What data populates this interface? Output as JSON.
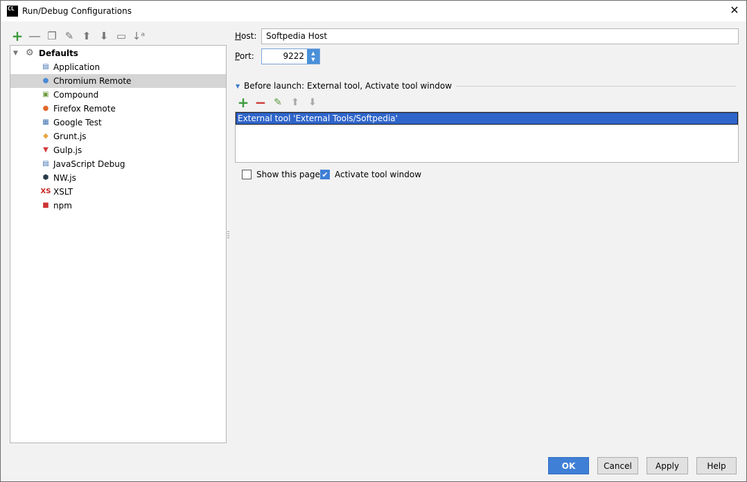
{
  "window": {
    "app_icon": "CL",
    "title": "Run/Debug Configurations",
    "close_glyph": "✕"
  },
  "left_toolbar": [
    {
      "name": "add-config-button",
      "icon": "plus-icon",
      "glyph": "+"
    },
    {
      "name": "remove-config-button",
      "icon": "minus-icon",
      "glyph": "—"
    },
    {
      "name": "copy-config-button",
      "icon": "copy-icon",
      "glyph": "❐"
    },
    {
      "name": "edit-defaults-button",
      "icon": "wrench-icon",
      "glyph": "✎"
    },
    {
      "name": "move-up-button",
      "icon": "arrow-up-icon",
      "glyph": "⬆"
    },
    {
      "name": "move-down-button",
      "icon": "arrow-down-icon",
      "glyph": "⬇"
    },
    {
      "name": "folder-button",
      "icon": "folder-icon",
      "glyph": "▭"
    },
    {
      "name": "sort-button",
      "icon": "sort-az-icon",
      "glyph": "↓ᵃ"
    }
  ],
  "tree": {
    "root_label": "Defaults",
    "items": [
      {
        "label": "Application",
        "icon": "application-icon",
        "glyph": "▤",
        "color": "#3c6fb0"
      },
      {
        "label": "Chromium Remote",
        "icon": "chromium-icon",
        "glyph": "●",
        "color": "#4a8ad4"
      },
      {
        "label": "Compound",
        "icon": "compound-icon",
        "glyph": "▣",
        "color": "#6a9a3a"
      },
      {
        "label": "Firefox Remote",
        "icon": "firefox-icon",
        "glyph": "●",
        "color": "#e0682a"
      },
      {
        "label": "Google Test",
        "icon": "google-test-icon",
        "glyph": "▦",
        "color": "#3c6fb0"
      },
      {
        "label": "Grunt.js",
        "icon": "grunt-icon",
        "glyph": "◆",
        "color": "#e8a33a"
      },
      {
        "label": "Gulp.js",
        "icon": "gulp-icon",
        "glyph": "▼",
        "color": "#d33a3a"
      },
      {
        "label": "JavaScript Debug",
        "icon": "javascript-debug-icon",
        "glyph": "▤",
        "color": "#3c6fb0"
      },
      {
        "label": "NW.js",
        "icon": "nwjs-icon",
        "glyph": "⬢",
        "color": "#2b3a4a"
      },
      {
        "label": "XSLT",
        "icon": "xslt-icon",
        "glyph": "XS",
        "color": "#cc2222"
      },
      {
        "label": "npm",
        "icon": "npm-icon",
        "glyph": "■",
        "color": "#cc3333"
      }
    ],
    "selected_index": 1
  },
  "form": {
    "host_label": "Host:",
    "host_mnemonic": "H",
    "host_rest": "ost:",
    "host_value": "Softpedia Host",
    "port_label": "Port:",
    "port_mnemonic": "P",
    "port_rest": "ort:",
    "port_value": "9222"
  },
  "before_launch": {
    "title": "Before launch: External tool, Activate tool window",
    "tasks": [
      "External tool 'External Tools/Softpedia'"
    ]
  },
  "checkboxes": {
    "show_page_label": "Show this page",
    "show_page_checked": false,
    "activate_tool_label": "Activate tool window",
    "activate_tool_checked": true
  },
  "buttons": {
    "ok": "OK",
    "cancel": "Cancel",
    "apply": "Apply",
    "help": "Help"
  },
  "colors": {
    "selection": "#2f65ca",
    "primary_button": "#3f7fd6",
    "add_green": "#3a9a3a",
    "remove_red": "#cc3333"
  }
}
